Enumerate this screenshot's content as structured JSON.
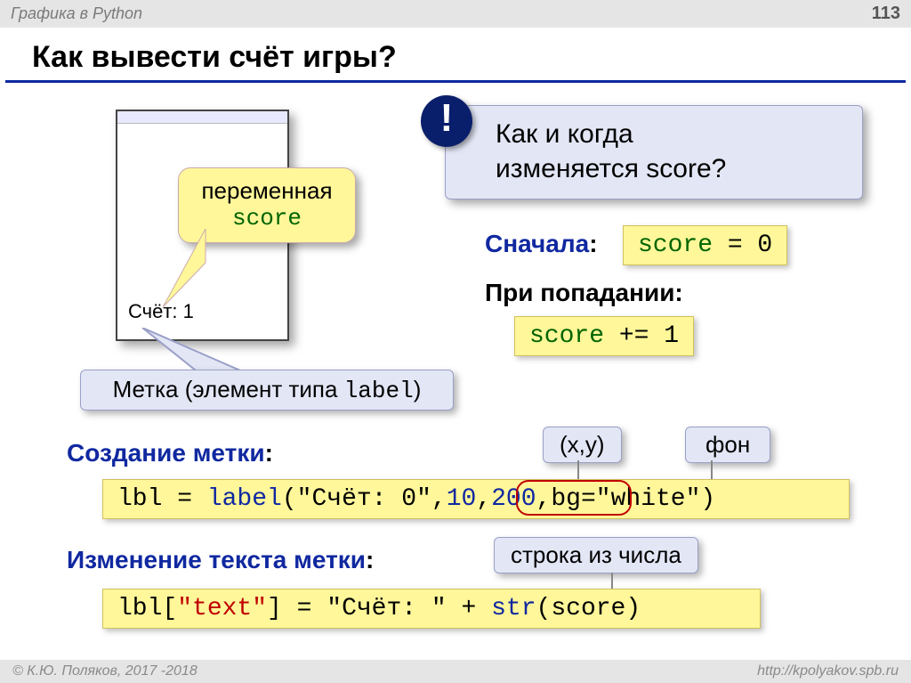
{
  "header": {
    "section": "Графика в Python",
    "page": "113"
  },
  "title": "Как вывести счёт игры?",
  "window": {
    "score_label": "Счёт: 1"
  },
  "bubble": {
    "line1": "переменная",
    "var": "score"
  },
  "labelbox": {
    "prefix": "Метка (элемент типа ",
    "code": "label",
    "suffix": ")"
  },
  "exclaim": {
    "mark": "!",
    "line1": "Как и когда",
    "line2": "изменяется score?"
  },
  "initially": {
    "label": "Сначала",
    "code_var": "score",
    "code_rest": " = 0"
  },
  "on_hit": {
    "label": "При попадании",
    "code_var": "score",
    "code_rest": " += 1"
  },
  "create": {
    "label": "Создание метки",
    "code_pre": "lbl = ",
    "code_fn": "label",
    "code_open": "(",
    "code_str": "\"Счёт: 0\"",
    "code_comma1": ",",
    "code_x": "10",
    "code_comma2": ",",
    "code_y": "200",
    "code_comma3": ",",
    "code_bg": "bg=",
    "code_bgval": "\"white\"",
    "code_close": ")"
  },
  "annot": {
    "xy": "(x,y)",
    "bg": "фон",
    "strnum": "строка из числа"
  },
  "change": {
    "label": "Изменение текста метки",
    "code_pre": "lbl[",
    "code_key": "\"text\"",
    "code_mid": "] = ",
    "code_str": "\"Счёт: \"",
    "code_plus": " + ",
    "code_fn": "str",
    "code_arg": "(score)"
  },
  "footer": {
    "left": "© К.Ю. Поляков, 2017 -2018",
    "right": "http://kpolyakov.spb.ru"
  }
}
